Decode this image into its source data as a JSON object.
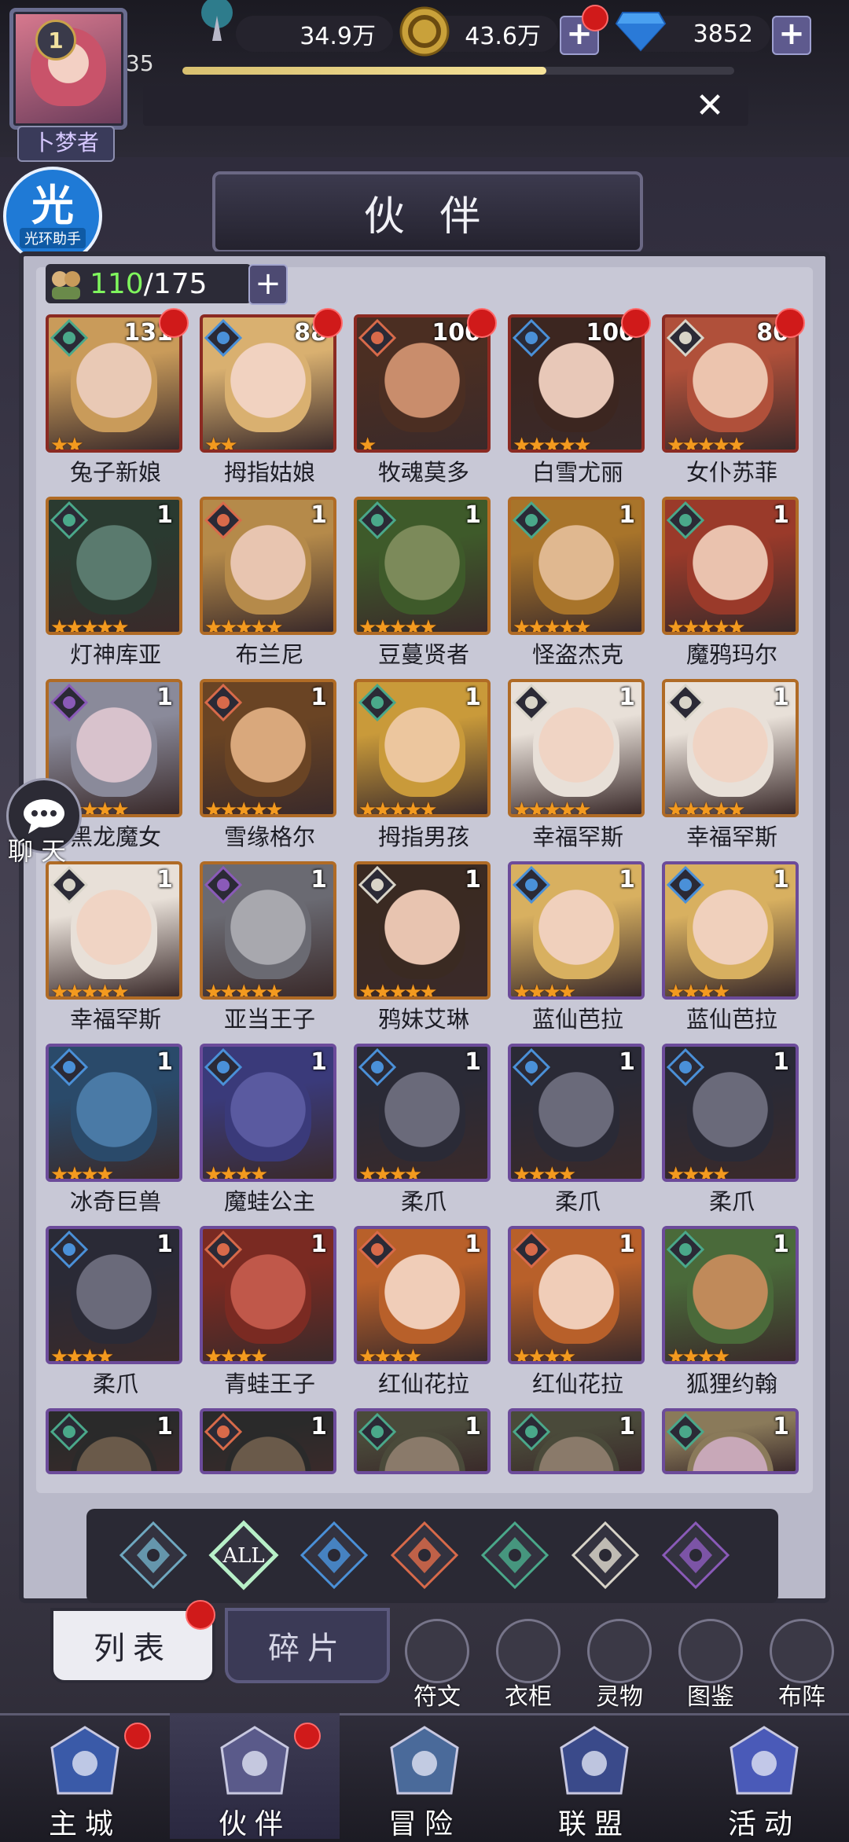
{
  "player": {
    "level_badge": "1",
    "level": "35",
    "title": "卜梦者",
    "xp_fraction": 0.66
  },
  "resources": {
    "power": "34.9万",
    "gold": "43.6万",
    "gems": "3852"
  },
  "helper": {
    "big": "光",
    "small": "光环助手"
  },
  "header": {
    "title": "伙 伴"
  },
  "roster": {
    "current": "110",
    "total": "/175"
  },
  "chat_label": "聊 天",
  "characters": [
    {
      "name": "兔子新娘",
      "level": "131",
      "stars": 2,
      "element": "wind",
      "frame": "red",
      "dot": true,
      "face": "#e9c9b5",
      "hair": "#c99b5a"
    },
    {
      "name": "拇指姑娘",
      "level": "88",
      "stars": 2,
      "element": "water",
      "frame": "red",
      "dot": true,
      "face": "#f1d2c0",
      "hair": "#d9b070"
    },
    {
      "name": "牧魂莫多",
      "level": "100",
      "stars": 1,
      "element": "fire",
      "frame": "red",
      "dot": true,
      "face": "#c98d6c",
      "hair": "#4b2e22"
    },
    {
      "name": "白雪尤丽",
      "level": "100",
      "stars": 5,
      "element": "water",
      "frame": "red",
      "dot": true,
      "face": "#e8c8b8",
      "hair": "#3c2620"
    },
    {
      "name": "女仆苏菲",
      "level": "80",
      "stars": 5,
      "element": "light",
      "frame": "red",
      "dot": true,
      "face": "#ecc4ae",
      "hair": "#b0503a"
    },
    {
      "name": "灯神库亚",
      "level": "1",
      "stars": 5,
      "element": "wind",
      "frame": "orange",
      "dot": false,
      "face": "#5a7a6e",
      "hair": "#2a3a30"
    },
    {
      "name": "布兰尼",
      "level": "1",
      "stars": 5,
      "element": "fire",
      "frame": "orange",
      "dot": false,
      "face": "#e8c5b0",
      "hair": "#b58a4a"
    },
    {
      "name": "豆蔓贤者",
      "level": "1",
      "stars": 5,
      "element": "wind",
      "frame": "orange",
      "dot": false,
      "face": "#7c8a5a",
      "hair": "#3e5a2a"
    },
    {
      "name": "怪盗杰克",
      "level": "1",
      "stars": 5,
      "element": "wind",
      "frame": "orange",
      "dot": false,
      "face": "#e0b890",
      "hair": "#a8742a"
    },
    {
      "name": "魔鸦玛尔",
      "level": "1",
      "stars": 5,
      "element": "wind",
      "frame": "orange",
      "dot": false,
      "face": "#eac2ae",
      "hair": "#9a3a2a"
    },
    {
      "name": "黑龙魔女",
      "level": "1",
      "stars": 5,
      "element": "dark",
      "frame": "orange",
      "dot": false,
      "face": "#d8c2cc",
      "hair": "#8a8a9a"
    },
    {
      "name": "雪缘格尔",
      "level": "1",
      "stars": 5,
      "element": "fire",
      "frame": "orange",
      "dot": false,
      "face": "#d9a87c",
      "hair": "#6a4424"
    },
    {
      "name": "拇指男孩",
      "level": "1",
      "stars": 5,
      "element": "wind",
      "frame": "orange",
      "dot": false,
      "face": "#ecc69e",
      "hair": "#c99a3a"
    },
    {
      "name": "幸福罕斯",
      "level": "1",
      "stars": 5,
      "element": "light",
      "frame": "orange",
      "dot": false,
      "face": "#f0d4c4",
      "hair": "#e8e0d8"
    },
    {
      "name": "幸福罕斯",
      "level": "1",
      "stars": 5,
      "element": "light",
      "frame": "orange",
      "dot": false,
      "face": "#f0d4c4",
      "hair": "#e8e0d8"
    },
    {
      "name": "幸福罕斯",
      "level": "1",
      "stars": 5,
      "element": "light",
      "frame": "orange",
      "dot": false,
      "face": "#f0d4c4",
      "hair": "#e8e0d8"
    },
    {
      "name": "亚当王子",
      "level": "1",
      "stars": 5,
      "element": "dark",
      "frame": "orange",
      "dot": false,
      "face": "#a8a8ae",
      "hair": "#6a6a72"
    },
    {
      "name": "鸦妹艾琳",
      "level": "1",
      "stars": 5,
      "element": "light",
      "frame": "orange",
      "dot": false,
      "face": "#e8c4b0",
      "hair": "#3a2a22"
    },
    {
      "name": "蓝仙芭拉",
      "level": "1",
      "stars": 4,
      "element": "water",
      "frame": "purple",
      "dot": false,
      "face": "#f0d0bc",
      "hair": "#d8b060"
    },
    {
      "name": "蓝仙芭拉",
      "level": "1",
      "stars": 4,
      "element": "water",
      "frame": "purple",
      "dot": false,
      "face": "#f0d0bc",
      "hair": "#d8b060"
    },
    {
      "name": "冰奇巨兽",
      "level": "1",
      "stars": 4,
      "element": "water",
      "frame": "purple",
      "dot": false,
      "face": "#4a7aa6",
      "hair": "#2a4a6a"
    },
    {
      "name": "魔蛙公主",
      "level": "1",
      "stars": 4,
      "element": "water",
      "frame": "purple",
      "dot": false,
      "face": "#5a5aa0",
      "hair": "#3a3a7a"
    },
    {
      "name": "柔爪",
      "level": "1",
      "stars": 4,
      "element": "water",
      "frame": "purple",
      "dot": false,
      "face": "#6a6a7a",
      "hair": "#2a2a36"
    },
    {
      "name": "柔爪",
      "level": "1",
      "stars": 4,
      "element": "water",
      "frame": "purple",
      "dot": false,
      "face": "#6a6a7a",
      "hair": "#2a2a36"
    },
    {
      "name": "柔爪",
      "level": "1",
      "stars": 4,
      "element": "water",
      "frame": "purple",
      "dot": false,
      "face": "#6a6a7a",
      "hair": "#2a2a36"
    },
    {
      "name": "柔爪",
      "level": "1",
      "stars": 4,
      "element": "water",
      "frame": "purple",
      "dot": false,
      "face": "#6a6a7a",
      "hair": "#2a2a36"
    },
    {
      "name": "青蛙王子",
      "level": "1",
      "stars": 4,
      "element": "fire",
      "frame": "purple",
      "dot": false,
      "face": "#c0584a",
      "hair": "#7a2a22"
    },
    {
      "name": "红仙花拉",
      "level": "1",
      "stars": 4,
      "element": "fire",
      "frame": "purple",
      "dot": false,
      "face": "#f0cdb8",
      "hair": "#b8602a"
    },
    {
      "name": "红仙花拉",
      "level": "1",
      "stars": 4,
      "element": "fire",
      "frame": "purple",
      "dot": false,
      "face": "#f0cdb8",
      "hair": "#b8602a"
    },
    {
      "name": "狐狸约翰",
      "level": "1",
      "stars": 4,
      "element": "wind",
      "frame": "purple",
      "dot": false,
      "face": "#c08a5a",
      "hair": "#4a6a3a"
    },
    {
      "name": "",
      "level": "1",
      "stars": 0,
      "element": "wind",
      "frame": "purple",
      "dot": false,
      "face": "#6a5a4a",
      "hair": "#2a2a2a"
    },
    {
      "name": "",
      "level": "1",
      "stars": 0,
      "element": "fire",
      "frame": "purple",
      "dot": false,
      "face": "#6a5a4a",
      "hair": "#2a2a2a"
    },
    {
      "name": "",
      "level": "1",
      "stars": 0,
      "element": "wind",
      "frame": "purple",
      "dot": false,
      "face": "#8a7a6a",
      "hair": "#4a4a3a"
    },
    {
      "name": "",
      "level": "1",
      "stars": 0,
      "element": "wind",
      "frame": "purple",
      "dot": false,
      "face": "#8a7a6a",
      "hair": "#4a4a3a"
    },
    {
      "name": "",
      "level": "1",
      "stars": 0,
      "element": "wind",
      "frame": "purple",
      "dot": false,
      "face": "#c8a8b8",
      "hair": "#8a7a5a"
    }
  ],
  "filters": [
    {
      "name": "wind-a",
      "label": "",
      "color": "#6fa8c0",
      "active": false
    },
    {
      "name": "all",
      "label": "ALL",
      "color": "#8ad8a8",
      "active": true
    },
    {
      "name": "water",
      "label": "",
      "color": "#4a90d8",
      "active": false
    },
    {
      "name": "fire",
      "label": "",
      "color": "#d86a4a",
      "active": false
    },
    {
      "name": "wind",
      "label": "",
      "color": "#4aa88a",
      "active": false
    },
    {
      "name": "light",
      "label": "",
      "color": "#d8d4c8",
      "active": false
    },
    {
      "name": "dark",
      "label": "",
      "color": "#8a5ab8",
      "active": false
    }
  ],
  "tabs": {
    "list": "列表",
    "shards": "碎片"
  },
  "tools": [
    "符文",
    "衣柜",
    "灵物",
    "图鉴",
    "布阵"
  ],
  "nav": [
    {
      "label": "主城",
      "dot": true
    },
    {
      "label": "伙伴",
      "dot": true
    },
    {
      "label": "冒险",
      "dot": false
    },
    {
      "label": "联盟",
      "dot": false
    },
    {
      "label": "活动",
      "dot": false
    }
  ]
}
